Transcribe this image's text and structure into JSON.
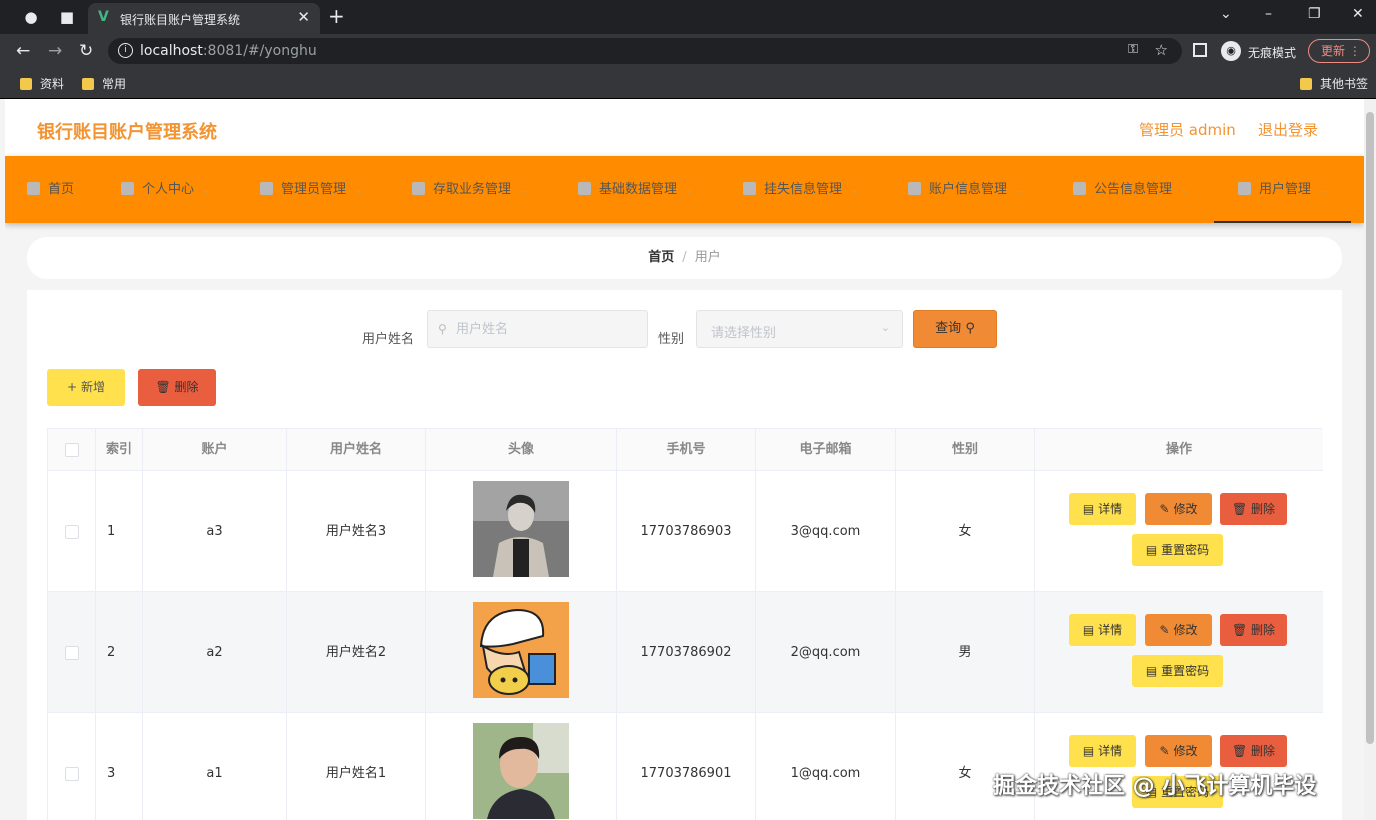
{
  "browser": {
    "tab_title": "银行账目账户管理系统",
    "url_host": "localhost",
    "url_rest": ":8081/#/yonghu",
    "incognito_label": "无痕模式",
    "update_label": "更新",
    "bookmarks": [
      "资料",
      "常用"
    ],
    "other_bookmarks": "其他书签"
  },
  "header": {
    "title": "银行账目账户管理系统",
    "admin": "管理员 admin",
    "logout": "退出登录"
  },
  "nav": {
    "items": [
      "首页",
      "个人中心",
      "管理员管理",
      "存取业务管理",
      "基础数据管理",
      "挂失信息管理",
      "账户信息管理",
      "公告信息管理",
      "用户管理"
    ]
  },
  "breadcrumb": {
    "home": "首页",
    "separator": "/",
    "current": "用户"
  },
  "search": {
    "name_label": "用户姓名",
    "name_placeholder": "用户姓名",
    "gender_label": "性别",
    "gender_placeholder": "请选择性别",
    "query_label": "查询"
  },
  "actions": {
    "add": "新增",
    "delete": "删除"
  },
  "table": {
    "headers": [
      "索引",
      "账户",
      "用户姓名",
      "头像",
      "手机号",
      "电子邮箱",
      "性别",
      "操作"
    ],
    "rows": [
      {
        "index": "1",
        "account": "a3",
        "name": "用户姓名3",
        "phone": "17703786903",
        "email": "3@qq.com",
        "gender": "女"
      },
      {
        "index": "2",
        "account": "a2",
        "name": "用户姓名2",
        "phone": "17703786902",
        "email": "2@qq.com",
        "gender": "男"
      },
      {
        "index": "3",
        "account": "a1",
        "name": "用户姓名1",
        "phone": "17703786901",
        "email": "1@qq.com",
        "gender": "女"
      }
    ],
    "op_labels": {
      "detail": "详情",
      "edit": "修改",
      "delete": "删除",
      "reset": "重置密码"
    }
  },
  "watermark": "掘金技术社区 @ 小飞计算机毕设",
  "colors": {
    "accent": "#ff8c00",
    "title": "#f39433",
    "yellow": "#ffe14d",
    "orange": "#f08a34",
    "red": "#e85e3f"
  }
}
